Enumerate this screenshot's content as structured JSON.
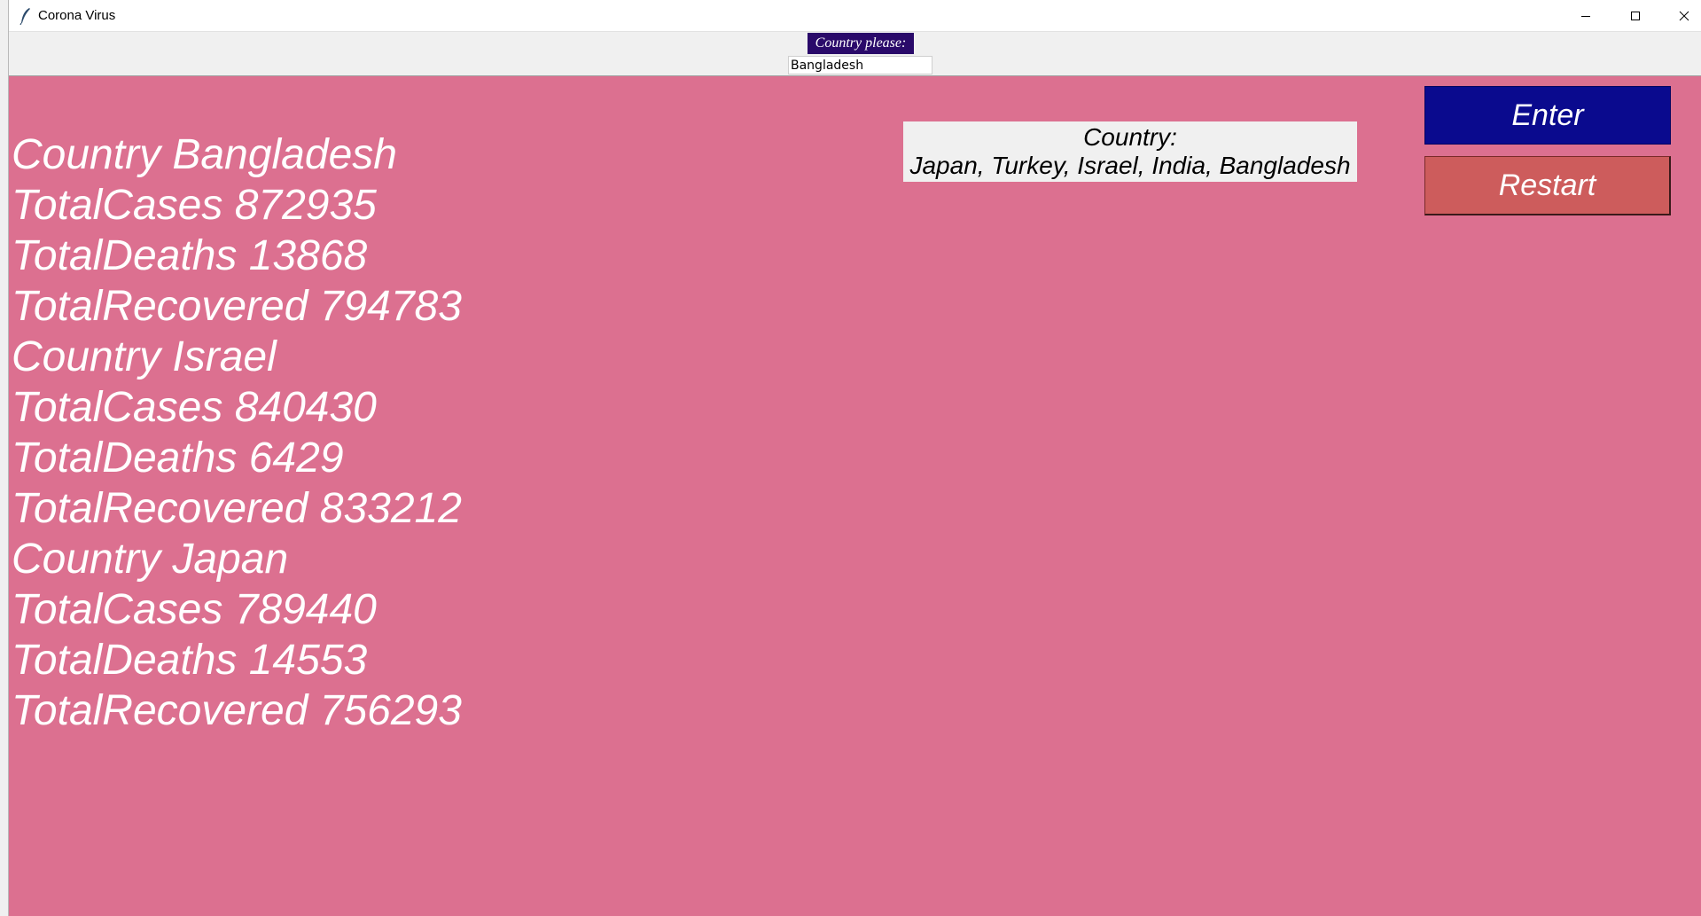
{
  "window": {
    "title": "Corona Virus"
  },
  "top": {
    "prompt_label": "Country please:",
    "input_value": "Bangladesh"
  },
  "results": [
    "Country Bangladesh",
    "TotalCases 872935",
    "TotalDeaths 13868",
    "TotalRecovered 794783",
    "Country Israel",
    "TotalCases 840430",
    "TotalDeaths 6429",
    "TotalRecovered 833212",
    "Country Japan",
    "TotalCases 789440",
    "TotalDeaths 14553",
    "TotalRecovered 756293"
  ],
  "hint": {
    "heading": "Country:",
    "countries": "Japan, Turkey, Israel, India, Bangladesh"
  },
  "buttons": {
    "enter": "Enter",
    "restart": "Restart"
  },
  "colors": {
    "main_background": "#dc7090",
    "prompt_label_bg": "#2a0a6a",
    "enter_bg": "#0a0a8e",
    "restart_bg": "#cd5c5c"
  },
  "icons": {
    "app": "feather-icon",
    "minimize": "minimize-icon",
    "maximize": "maximize-icon",
    "close": "close-icon"
  }
}
